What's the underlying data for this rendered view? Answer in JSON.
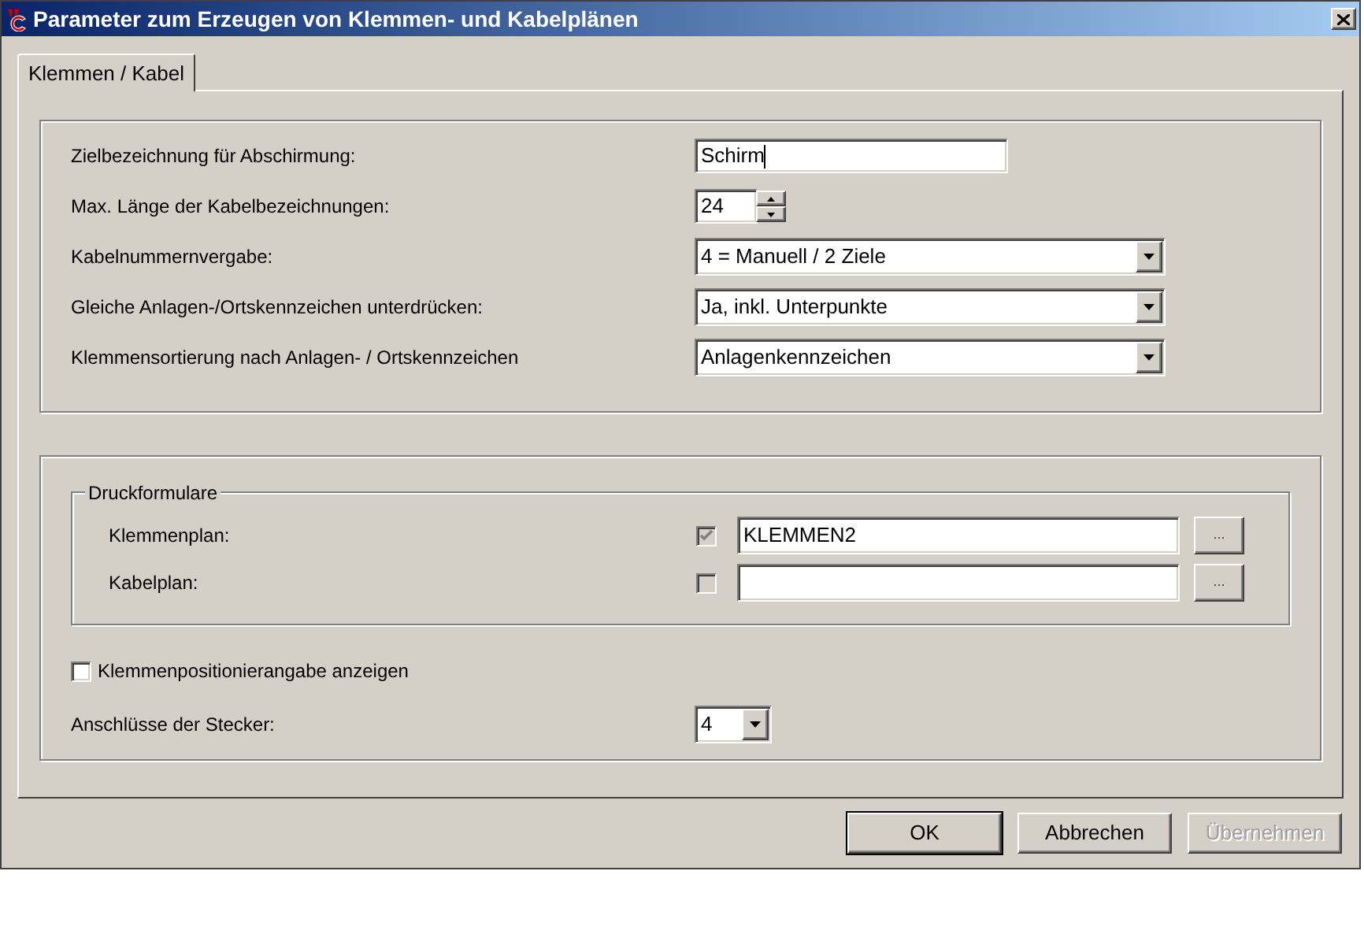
{
  "window": {
    "title": "Parameter zum Erzeugen von Klemmen- und Kabelplänen"
  },
  "tabs": [
    {
      "label": "Klemmen / Kabel",
      "selected": true
    }
  ],
  "settings": [
    {
      "kind": "text",
      "label": "Zielbezeichnung für Abschirmung:",
      "value": "Schirm"
    },
    {
      "kind": "spin",
      "label": "Max. Länge der Kabelbezeichnungen:",
      "value": "24"
    },
    {
      "kind": "select",
      "label": "Kabelnummernvergabe:",
      "value": "4 = Manuell / 2 Ziele"
    },
    {
      "kind": "select",
      "label": "Gleiche Anlagen-/Ortskennzeichen unterdrücken:",
      "value": "Ja, inkl. Unterpunkte"
    },
    {
      "kind": "select",
      "label": "Klemmensortierung nach Anlagen- / Ortskennzeichen",
      "value": "Anlagenkennzeichen"
    }
  ],
  "print_forms": {
    "legend": "Druckformulare",
    "rows": [
      {
        "label": "Klemmenplan:",
        "checked": true,
        "disabled": true,
        "value": "KLEMMEN2",
        "browse": "..."
      },
      {
        "label": "Kabelplan:",
        "checked": false,
        "disabled": true,
        "value": "",
        "browse": "..."
      }
    ]
  },
  "show_position": {
    "label": "Klemmenpositionierangabe anzeigen",
    "checked": false
  },
  "connector": {
    "label": "Anschlüsse der Stecker:",
    "value": "4"
  },
  "buttons": [
    {
      "label": "OK",
      "default": true,
      "disabled": false
    },
    {
      "label": "Abbrechen",
      "default": false,
      "disabled": false
    },
    {
      "label": "Übernehmen",
      "default": false,
      "disabled": true
    }
  ]
}
